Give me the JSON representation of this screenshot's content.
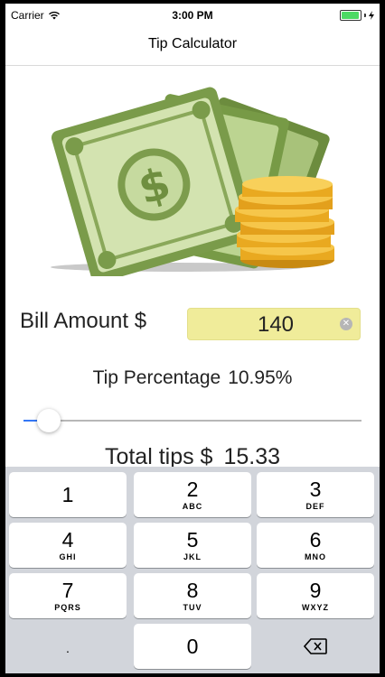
{
  "status_bar": {
    "carrier": "Carrier",
    "time": "3:00 PM"
  },
  "nav": {
    "title": "Tip Calculator"
  },
  "hero": {
    "image": "money-bills-and-coins-illustration"
  },
  "bill": {
    "label": "Bill Amount $",
    "value": "140"
  },
  "tip": {
    "label": "Tip Percentage",
    "value": "10.95%",
    "slider_fraction": 0.075
  },
  "total": {
    "label": "Total tips $",
    "value": "15.33"
  },
  "keypad": {
    "keys": [
      {
        "num": "1",
        "letters": ""
      },
      {
        "num": "2",
        "letters": "ABC"
      },
      {
        "num": "3",
        "letters": "DEF"
      },
      {
        "num": "4",
        "letters": "GHI"
      },
      {
        "num": "5",
        "letters": "JKL"
      },
      {
        "num": "6",
        "letters": "MNO"
      },
      {
        "num": "7",
        "letters": "PQRS"
      },
      {
        "num": "8",
        "letters": "TUV"
      },
      {
        "num": "9",
        "letters": "WXYZ"
      },
      {
        "num": ".",
        "letters": ""
      },
      {
        "num": "0",
        "letters": ""
      }
    ],
    "delete_icon": "backspace-icon"
  },
  "colors": {
    "bill_field": "#f0ec9a",
    "keypad_bg": "#d2d5db",
    "battery": "#4cd964",
    "slider_fill": "#3478f6"
  }
}
